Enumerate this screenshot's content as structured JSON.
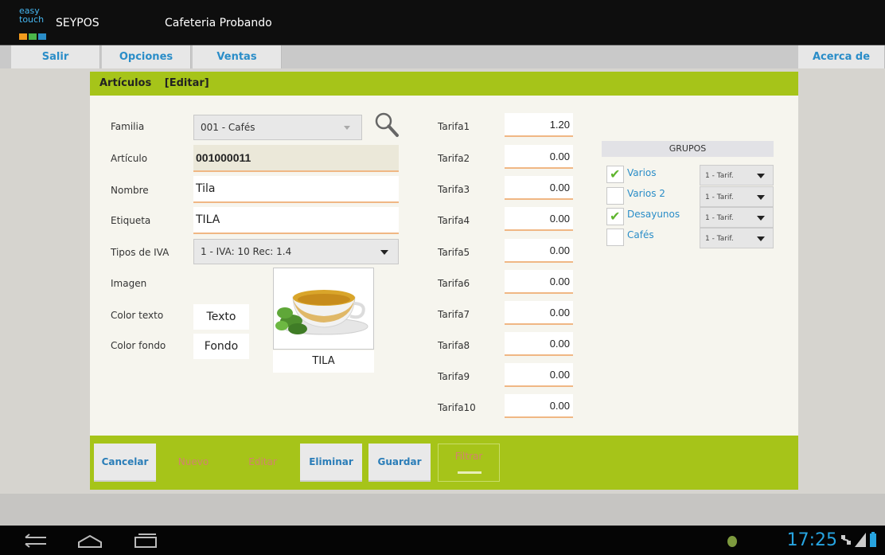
{
  "titlebar": {
    "logo_line1": "easy",
    "logo_line2": "touch",
    "app_name": "SEYPOS",
    "shop_name": "Cafeteria Probando"
  },
  "menu": {
    "salir": "Salir",
    "opciones": "Opciones",
    "ventas": "Ventas",
    "acerca": "Acerca de"
  },
  "panel": {
    "title": "Artículos",
    "mode": "[Editar]"
  },
  "form": {
    "familia_label": "Familia",
    "familia_value": "001 - Cafés",
    "articulo_label": "Artículo",
    "articulo_value": "001000011",
    "nombre_label": "Nombre",
    "nombre_value": "Tila",
    "etiqueta_label": "Etiqueta",
    "etiqueta_value": "TILA",
    "iva_label": "Tipos de IVA",
    "iva_value": "1 - IVA: 10 Rec: 1.4",
    "imagen_label": "Imagen",
    "color_texto_label": "Color texto",
    "color_texto_value": "Texto",
    "color_fondo_label": "Color fondo",
    "color_fondo_value": "Fondo",
    "image_caption": "TILA"
  },
  "tarifas": [
    {
      "label": "Tarifa1",
      "value": "1.20"
    },
    {
      "label": "Tarifa2",
      "value": "0.00"
    },
    {
      "label": "Tarifa3",
      "value": "0.00"
    },
    {
      "label": "Tarifa4",
      "value": "0.00"
    },
    {
      "label": "Tarifa5",
      "value": "0.00"
    },
    {
      "label": "Tarifa6",
      "value": "0.00"
    },
    {
      "label": "Tarifa7",
      "value": "0.00"
    },
    {
      "label": "Tarifa8",
      "value": "0.00"
    },
    {
      "label": "Tarifa9",
      "value": "0.00"
    },
    {
      "label": "Tarifa10",
      "value": "0.00"
    }
  ],
  "grupos": {
    "header": "GRUPOS",
    "items": [
      {
        "label": "Varios",
        "checked": true,
        "tarifa": "1 - Tarif."
      },
      {
        "label": "Varios 2",
        "checked": false,
        "tarifa": "1 - Tarif."
      },
      {
        "label": "Desayunos",
        "checked": true,
        "tarifa": "1 - Tarif."
      },
      {
        "label": "Cafés",
        "checked": false,
        "tarifa": "1 - Tarif."
      }
    ]
  },
  "footer": {
    "cancelar": "Cancelar",
    "nuevo": "Nuevo",
    "editar": "Editar",
    "eliminar": "Eliminar",
    "guardar": "Guardar",
    "filtrar": "Filtrar"
  },
  "statusbar": {
    "clock": "17:25"
  },
  "colors": {
    "accent_green": "#a6c419",
    "link_blue": "#2a8dc8",
    "clock_blue": "#27a4e0",
    "check_green": "#5fb52e"
  }
}
